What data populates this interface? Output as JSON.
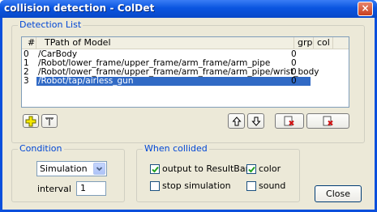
{
  "window": {
    "title": "collision detection - ColDet",
    "close_glyph": "×"
  },
  "detection": {
    "group_label": "Detection List",
    "columns": [
      "#",
      "TPath of Model",
      "grp",
      "col"
    ],
    "rows": [
      {
        "num": "0",
        "path": "/CarBody",
        "grp": "0",
        "col": "",
        "selected": false
      },
      {
        "num": "1",
        "path": "/Robot/lower_frame/upper_frame/arm_frame/arm_pipe",
        "grp": "0",
        "col": "",
        "selected": false
      },
      {
        "num": "2",
        "path": "/Robot/lower_frame/upper_frame/arm_frame/arm_pipe/wrist_body",
        "grp": "0",
        "col": "",
        "selected": false
      },
      {
        "num": "3",
        "path": "/Robot/tap/airless_gun",
        "grp": "0",
        "col": "",
        "selected": true
      }
    ],
    "toolbar": {
      "add_icon": "add-plus-icon",
      "tree_icon": "tree-icon",
      "up_icon": "arrow-up-icon",
      "down_icon": "arrow-down-icon",
      "remove_icon": "remove-icon",
      "remove_all_icon": "remove-all-icon"
    }
  },
  "condition": {
    "group_label": "Condition",
    "mode_value": "Simulation",
    "interval_label": "interval",
    "interval_value": "1"
  },
  "when_collided": {
    "group_label": "When collided",
    "output_to_resultbar": {
      "label": "output to ResultBar",
      "checked": true
    },
    "color": {
      "label": "color",
      "checked": true
    },
    "stop_simulation": {
      "label": "stop simulation",
      "checked": false
    },
    "sound": {
      "label": "sound",
      "checked": false
    }
  },
  "close_button_label": "Close",
  "colors": {
    "titlebar": "#0a55e0",
    "selection": "#316ac5",
    "group_label": "#0046d5",
    "dialog_bg": "#ece9d8"
  }
}
